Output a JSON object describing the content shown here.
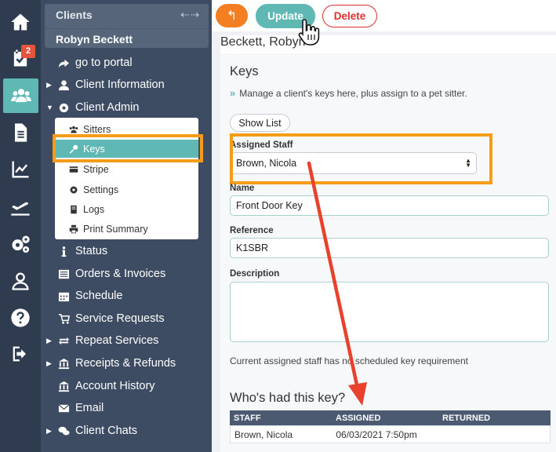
{
  "rail": {
    "items": [
      {
        "icon": "home-icon"
      },
      {
        "icon": "tasks-icon",
        "badge": "2"
      },
      {
        "icon": "users-icon",
        "active": true
      },
      {
        "icon": "document-icon"
      },
      {
        "icon": "chart-icon"
      },
      {
        "icon": "travel-icon"
      },
      {
        "icon": "settings-icon"
      },
      {
        "icon": "user-icon"
      },
      {
        "icon": "help-icon"
      },
      {
        "icon": "logout-icon"
      }
    ]
  },
  "sidebar": {
    "header_title": "Clients",
    "header_arrows": "⇠⇢",
    "client_name": "Robyn Beckett",
    "nav": [
      {
        "label": "go to portal",
        "icon": "share-icon",
        "caret": ""
      },
      {
        "label": "Client Information",
        "icon": "user-icon",
        "caret": "▶"
      },
      {
        "label": "Client Admin",
        "icon": "gear-icon",
        "caret": "▼"
      },
      {
        "label": "Status",
        "icon": "info-icon",
        "caret": ""
      },
      {
        "label": "Orders & Invoices",
        "icon": "list-icon",
        "caret": ""
      },
      {
        "label": "Schedule",
        "icon": "calendar-icon",
        "caret": ""
      },
      {
        "label": "Service Requests",
        "icon": "cart-icon",
        "caret": ""
      },
      {
        "label": "Repeat Services",
        "icon": "repeat-icon",
        "caret": "▶"
      },
      {
        "label": "Receipts & Refunds",
        "icon": "bank-icon",
        "caret": "▶"
      },
      {
        "label": "Account History",
        "icon": "bank-icon",
        "caret": ""
      },
      {
        "label": "Email",
        "icon": "envelope-icon",
        "caret": ""
      },
      {
        "label": "Client Chats",
        "icon": "chat-icon",
        "caret": "▶"
      }
    ],
    "submenu": [
      {
        "label": "Sitters",
        "icon": "users-icon"
      },
      {
        "label": "Keys",
        "icon": "key-icon",
        "active": true
      },
      {
        "label": "Stripe",
        "icon": "card-icon"
      },
      {
        "label": "Settings",
        "icon": "gear-icon"
      },
      {
        "label": "Logs",
        "icon": "book-icon"
      },
      {
        "label": "Print Summary",
        "icon": "print-icon"
      }
    ]
  },
  "toolbar": {
    "back_glyph": "↰",
    "update_label": "Update",
    "delete_label": "Delete"
  },
  "page_title": "Beckett, Robyn",
  "keys": {
    "title": "Keys",
    "description": "Manage a client's keys here, plus assign to a pet sitter.",
    "desc_glyph": "»",
    "show_list_label": "Show List",
    "assigned_staff_label": "Assigned Staff",
    "assigned_staff_value": "Brown, Nicola",
    "name_label": "Name",
    "name_value": "Front Door Key",
    "reference_label": "Reference",
    "reference_value": "K1SBR",
    "description_label": "Description",
    "description_value": "",
    "note": "Current assigned staff has no scheduled key requirement",
    "history_title": "Who's had this key?",
    "table": {
      "headers": [
        "STAFF",
        "ASSIGNED",
        "RETURNED"
      ],
      "rows": [
        [
          "Brown, Nicola",
          "06/03/2021 7:50pm",
          ""
        ]
      ]
    }
  },
  "colors": {
    "accent": "#5fb8b4",
    "highlight": "#f79c19",
    "arrow": "#e8412c",
    "danger": "#d9302e",
    "back": "#f47f23"
  }
}
